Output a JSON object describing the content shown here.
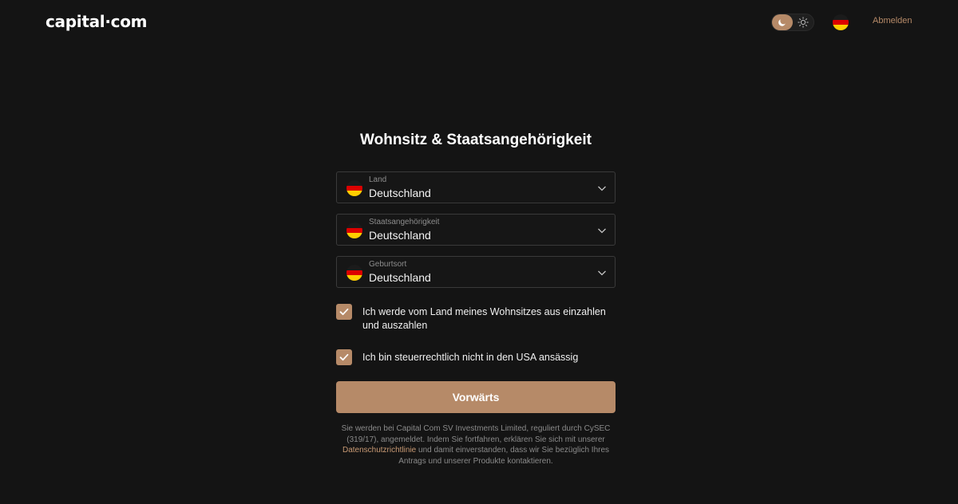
{
  "header": {
    "logo": "capital·com",
    "theme": {
      "active": "dark"
    },
    "language_flag": "germany-flag",
    "logout_label": "Abmelden"
  },
  "form": {
    "title": "Wohnsitz & Staatsangehörigkeit",
    "fields": [
      {
        "label": "Land",
        "value": "Deutschland",
        "flag": "germany-flag"
      },
      {
        "label": "Staatsangehörigkeit",
        "value": "Deutschland",
        "flag": "germany-flag"
      },
      {
        "label": "Geburtsort",
        "value": "Deutschland",
        "flag": "germany-flag"
      }
    ],
    "checkboxes": [
      {
        "label": "Ich werde vom Land meines Wohnsitzes aus einzahlen und auszahlen",
        "checked": true
      },
      {
        "label": "Ich bin steuerrechtlich nicht in den USA ansässig",
        "checked": true
      }
    ],
    "submit_label": "Vorwärts",
    "disclaimer": {
      "before": "Sie werden bei Capital Com SV Investments Limited, reguliert durch CySEC (319/17), angemeldet. Indem Sie fortfahren, erklären Sie sich mit unserer ",
      "link": "Datenschutzrichtlinie",
      "after": " und damit einverstanden, dass wir Sie bezüglich Ihres Antrags und unserer Produkte kontaktieren."
    }
  },
  "colors": {
    "background": "#141414",
    "accent": "#b68a68",
    "link": "#c99a74"
  }
}
